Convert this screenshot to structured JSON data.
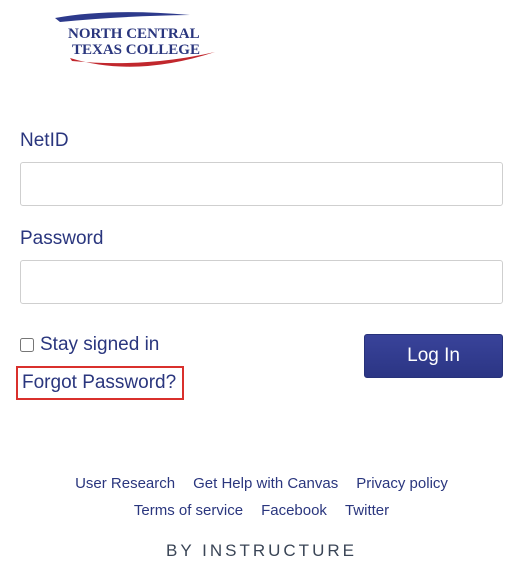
{
  "logo": {
    "line1": "NORTH CENTRAL",
    "line2": "TEXAS COLLEGE"
  },
  "form": {
    "netid_label": "NetID",
    "netid_value": "",
    "password_label": "Password",
    "password_value": "",
    "stay_signed_label": "Stay signed in",
    "forgot_password_label": "Forgot Password?",
    "login_button_label": "Log In"
  },
  "footer": {
    "links_row1": {
      "user_research": "User Research",
      "get_help": "Get Help with Canvas",
      "privacy": "Privacy policy"
    },
    "links_row2": {
      "terms": "Terms of service",
      "facebook": "Facebook",
      "twitter": "Twitter"
    },
    "by_instructure": "BY INSTRUCTURE"
  }
}
